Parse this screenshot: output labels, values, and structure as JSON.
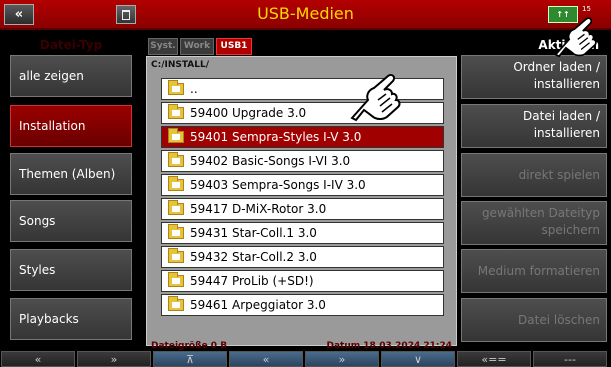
{
  "title_bar": {
    "back_label": "«",
    "title": "USB-Medien",
    "midi_label": "↑↑",
    "clock": "15"
  },
  "left_panel": {
    "header": "Datei-Typ",
    "categories": [
      {
        "label": "alle zeigen",
        "active": false
      },
      {
        "label": "Installation",
        "active": true
      },
      {
        "label": "Themen (Alben)",
        "active": false
      },
      {
        "label": "Songs",
        "active": false
      },
      {
        "label": "Styles",
        "active": false
      },
      {
        "label": "Playbacks",
        "active": false
      }
    ]
  },
  "browser": {
    "tabs": [
      {
        "label": "Syst.",
        "active": false
      },
      {
        "label": "Work",
        "active": false
      },
      {
        "label": "USB1",
        "active": true
      }
    ],
    "path": "C:/INSTALL/",
    "files": [
      {
        "name": "..",
        "selected": false
      },
      {
        "name": "59400 Upgrade 3.0",
        "selected": false
      },
      {
        "name": "59401 Sempra-Styles I-V 3.0",
        "selected": true
      },
      {
        "name": "59402 Basic-Songs I-VI 3.0",
        "selected": false
      },
      {
        "name": "59403 Sempra-Songs I-IV 3.0",
        "selected": false
      },
      {
        "name": "59417 D-MiX-Rotor 3.0",
        "selected": false
      },
      {
        "name": "59431 Star-Coll.1 3.0",
        "selected": false
      },
      {
        "name": "59432 Star-Coll.2 3.0",
        "selected": false
      },
      {
        "name": "59447 ProLib (+SD!)",
        "selected": false
      },
      {
        "name": "59461 Arpeggiator 3.0",
        "selected": false
      }
    ],
    "status_size": "Dateigröße 0 B",
    "status_date": "Datum 18.03.2024   21:24"
  },
  "right_panel": {
    "header": "Aktionen",
    "actions": [
      {
        "line1": "Ordner laden /",
        "line2": "installieren",
        "enabled": true
      },
      {
        "line1": "Datei laden /",
        "line2": "installieren",
        "enabled": true
      },
      {
        "line1": "direkt spielen",
        "line2": "",
        "enabled": false
      },
      {
        "line1": "gewählten Dateityp",
        "line2": "speichern",
        "enabled": false
      },
      {
        "line1": "Medium formatieren",
        "line2": "",
        "enabled": false
      },
      {
        "line1": "Datei löschen",
        "line2": "",
        "enabled": false
      }
    ]
  },
  "bottom_bar": {
    "buttons": [
      "«",
      "»",
      "⊼",
      "«",
      "»",
      "∨",
      "«==",
      "---"
    ]
  },
  "colors": {
    "accent_red": "#a00000",
    "title_yellow": "#ffd800"
  }
}
